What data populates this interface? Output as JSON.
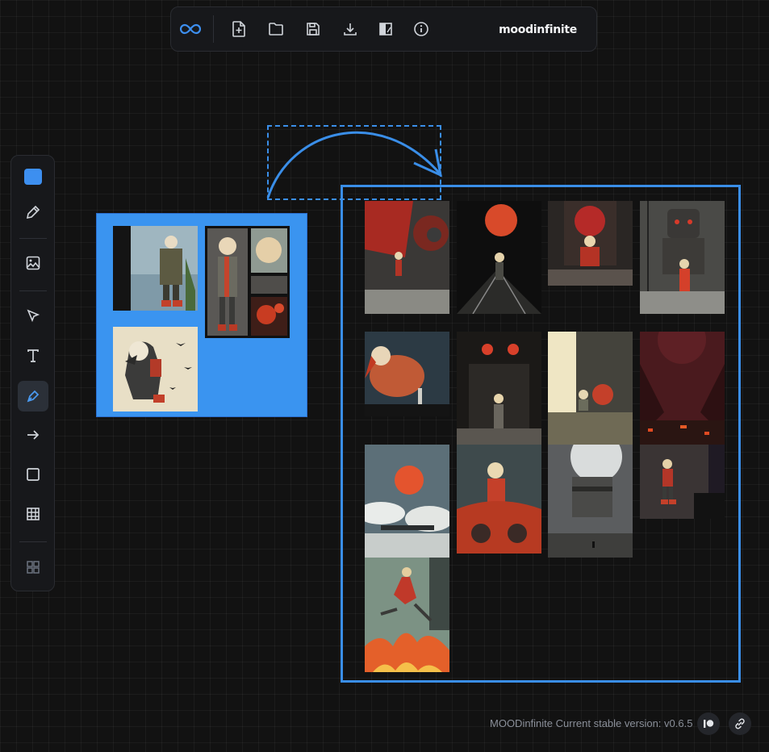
{
  "toolbar": {
    "brand": "moodinfinite",
    "buttons": [
      {
        "name": "logo-infinity-icon"
      },
      {
        "name": "new-file-icon"
      },
      {
        "name": "open-folder-icon"
      },
      {
        "name": "save-icon"
      },
      {
        "name": "download-icon"
      },
      {
        "name": "theme-toggle-icon"
      },
      {
        "name": "info-icon"
      }
    ]
  },
  "sidebar": {
    "tools": [
      {
        "name": "color-swatch",
        "color": "#3d8ff0"
      },
      {
        "name": "eyedropper-icon"
      },
      {
        "name": "image-icon"
      },
      {
        "name": "select-pointer-icon"
      },
      {
        "name": "text-icon"
      },
      {
        "name": "pen-icon",
        "active": true
      },
      {
        "name": "arrow-right-icon"
      },
      {
        "name": "square-icon"
      },
      {
        "name": "grid-table-icon"
      },
      {
        "name": "apps-grid-icon"
      }
    ]
  },
  "canvas": {
    "accent": "#3a8ee8",
    "group_fill": "#3a94f0"
  },
  "footer": {
    "version_text": "MOODinfinite Current stable version: v0.6.5",
    "buttons": [
      {
        "name": "patreon-icon"
      },
      {
        "name": "link-icon"
      }
    ]
  }
}
